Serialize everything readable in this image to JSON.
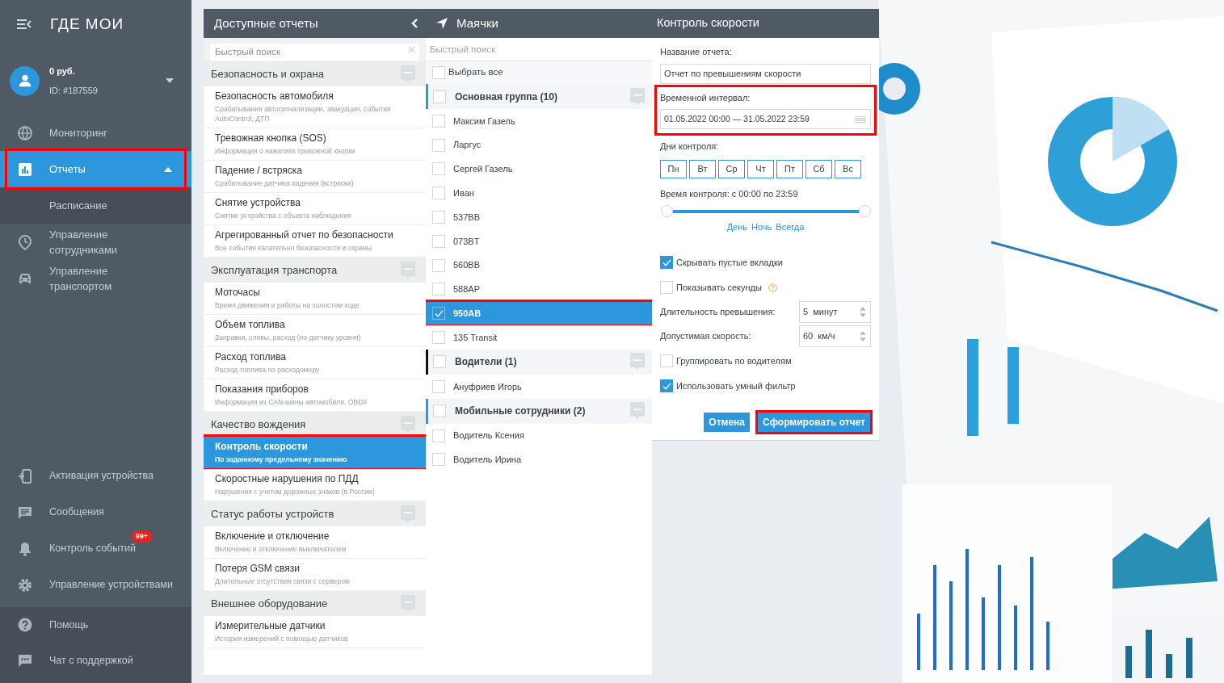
{
  "sidebar": {
    "logo": "ГДЕ МОИ",
    "account": {
      "balance": "0 руб.",
      "id": "ID: #187559"
    },
    "items": [
      {
        "label": "Мониторинг",
        "selected": false,
        "highlighted": false
      },
      {
        "label": "Отчеты",
        "selected": true,
        "highlighted": true,
        "expanded": true,
        "children": [
          {
            "label": "Расписание"
          }
        ]
      },
      {
        "label": "Управление сотрудниками",
        "selected": false,
        "highlighted": false
      },
      {
        "label": "Управление транспортом",
        "selected": false,
        "highlighted": false
      }
    ],
    "bottom_items": [
      {
        "label": "Активация устройства"
      },
      {
        "label": "Сообщения"
      },
      {
        "label": "Контроль событий",
        "badge": "99+"
      },
      {
        "label": "Управление устройствами"
      }
    ],
    "footer_items": [
      {
        "label": "Помощь"
      },
      {
        "label": "Чат с поддержкой"
      }
    ]
  },
  "reports": {
    "title": "Доступные отчеты",
    "search": {
      "placeholder": "Быстрый поиск"
    },
    "sections": [
      {
        "title": "Безопасность и охрана",
        "items": [
          {
            "title": "Безопасность автомобиля",
            "subtitle": "Срабатывания автосигнализации, эвакуация, события AutoControl, ДТП",
            "selected": false
          },
          {
            "title": "Тревожная кнопка (SOS)",
            "subtitle": "Информация о нажатиях тревожной кнопки",
            "selected": false
          },
          {
            "title": "Падение / встряска",
            "subtitle": "Срабатывание датчика падения (встряски)",
            "selected": false
          },
          {
            "title": "Снятие устройства",
            "subtitle": "Снятие устройства с объекта наблюдения",
            "selected": false
          },
          {
            "title": "Агрегированный отчет по безопасности",
            "subtitle": "Все события касательно безопасности и охраны",
            "selected": false
          }
        ]
      },
      {
        "title": "Эксплуатация транспорта",
        "items": [
          {
            "title": "Моточасы",
            "subtitle": "Время движения и работы на холостом ходе",
            "selected": false
          },
          {
            "title": "Объем топлива",
            "subtitle": "Заправки, сливы, расход (по датчику уровня)",
            "selected": false
          },
          {
            "title": "Расход топлива",
            "subtitle": "Расход топлива по расходомеру",
            "selected": false
          },
          {
            "title": "Показания приборов",
            "subtitle": "Информация из CAN-шины автомобиля, OBDII",
            "selected": false
          }
        ]
      },
      {
        "title": "Качество вождения",
        "items": [
          {
            "title": "Контроль скорости",
            "subtitle": "По заданному предельному значению",
            "selected": true
          },
          {
            "title": "Скоростные нарушения по ПДД",
            "subtitle": "Нарушения с учетом дорожных знаков (в России)",
            "selected": false
          }
        ]
      },
      {
        "title": "Статус работы устройств",
        "items": [
          {
            "title": "Включение и отключение",
            "subtitle": "Включение и отключение выключателем",
            "selected": false
          },
          {
            "title": "Потеря GSM связи",
            "subtitle": "Длительные отсутствия связи с сервером",
            "selected": false
          }
        ]
      },
      {
        "title": "Внешнее оборудование",
        "items": [
          {
            "title": "Измерительные датчики",
            "subtitle": "История измерений с помощью датчиков",
            "selected": false
          }
        ]
      }
    ]
  },
  "beacons": {
    "title": "Маячки",
    "search": {
      "placeholder": "Быстрый поиск"
    },
    "select_all": {
      "label": "Выбрать все",
      "checked": false
    },
    "groups": [
      {
        "name": "Основная группа (10)",
        "checked": false,
        "color": "#2d9be0",
        "children": [
          {
            "name": "Максим Газель",
            "checked": false,
            "selected": false
          },
          {
            "name": "Ларгус",
            "checked": false,
            "selected": false
          },
          {
            "name": "Сергей Газель",
            "checked": false,
            "selected": false
          },
          {
            "name": "Иван",
            "checked": false,
            "selected": false
          },
          {
            "name": "537BB",
            "checked": false,
            "selected": false
          },
          {
            "name": "073BT",
            "checked": false,
            "selected": false
          },
          {
            "name": "560BB",
            "checked": false,
            "selected": false
          },
          {
            "name": "588AP",
            "checked": false,
            "selected": false
          },
          {
            "name": "950AB",
            "checked": true,
            "selected": true
          },
          {
            "name": "135 Transit",
            "checked": false,
            "selected": false
          }
        ]
      },
      {
        "name": "Водители (1)",
        "checked": false,
        "color": "#111111",
        "children": [
          {
            "name": "Ануфриев Игорь",
            "checked": false,
            "selected": false
          }
        ]
      },
      {
        "name": "Мобильные сотрудники (2)",
        "checked": false,
        "color": "#2d9be0",
        "children": [
          {
            "name": "Водитель Ксения",
            "checked": false,
            "selected": false
          },
          {
            "name": "Водитель Ирина",
            "checked": false,
            "selected": false
          }
        ]
      }
    ]
  },
  "speed_control": {
    "title": "Контроль скорости",
    "report_name": {
      "label": "Название отчета:",
      "value": "Отчет по превышениям скорости"
    },
    "interval": {
      "label": "Временной интервал:",
      "value": "01.05.2022 00:00 — 31.05.2022 23:59",
      "highlighted": true
    },
    "days": {
      "label": "Дни контроля:",
      "items": [
        "Пн",
        "Вт",
        "Ср",
        "Чт",
        "Пт",
        "Сб",
        "Вс"
      ]
    },
    "time": {
      "label": "Время контроля: с 00:00 по 23:59",
      "level": 1,
      "presets": [
        "День",
        "Ночь",
        "Всегда"
      ]
    },
    "options": [
      {
        "kind": "checkbox",
        "label": "Скрывать пустые вкладки",
        "checked": true
      },
      {
        "kind": "checkbox",
        "label": "Показывать секунды",
        "checked": false,
        "help": true
      },
      {
        "kind": "spinner",
        "label": "Длительность превышения:",
        "value": "5  минут"
      },
      {
        "kind": "spinner",
        "label": "Допустимая скорость:",
        "value": "60  км/ч"
      },
      {
        "kind": "checkbox",
        "label": "Группировать по водителям",
        "checked": false
      },
      {
        "kind": "checkbox",
        "label": "Использовать умный фильтр",
        "checked": true
      }
    ],
    "buttons": [
      {
        "label": "Отмена",
        "highlighted": false
      },
      {
        "label": "Сформировать отчет",
        "highlighted": true
      }
    ]
  }
}
